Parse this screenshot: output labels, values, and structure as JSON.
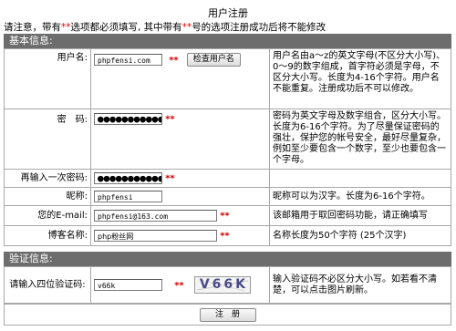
{
  "page": {
    "title": "用户注册",
    "notice_prefix": "请注意，带有",
    "notice_star1": "**",
    "notice_middle": "选项都必须填写, 其中带有",
    "notice_star2": "**",
    "notice_suffix": "号的选项注册成功后将不能修改"
  },
  "sections": {
    "basic": "基本信息:",
    "verify": "验证信息:"
  },
  "fields": {
    "username": {
      "label": "用户名:",
      "value": "phpfensi.com",
      "required": "**",
      "check_button": "检查用户名",
      "hint": "用户名由a～z的英文字母(不区分大小写)、0～9的数字组成，首字符必须是字母，不区分大小写。长度为4-16个字符。用户名不能重复。注册成功后不可以修改。"
    },
    "password": {
      "label": "密　码:",
      "value": "●●●●●●●●●●●",
      "required": "**",
      "hint": "密码为英文字母及数字组合，区分大小写。长度为6-16个字符。为了尽量保证密码的强壮，保护您的帐号安全，最好尽量复杂，例如至少要包含一个数字，至少也要包含一个字母。"
    },
    "password_confirm": {
      "label": "再输入一次密码:",
      "value": "●●●●●●●●●●●",
      "required": "**",
      "hint": ""
    },
    "nickname": {
      "label": "昵称:",
      "value": "phpfensi",
      "hint": "昵称可以为汉字。长度为6-16个字符。"
    },
    "email": {
      "label": "您的E-mail:",
      "value": "phpfensi@163.com",
      "required": "**",
      "hint": "该邮箱用于取回密码功能，请正确填写"
    },
    "blog": {
      "label": "博客名称:",
      "value": "php粉丝网",
      "required": "**",
      "hint": "名称长度为50个字符 (25个汉字)"
    },
    "captcha": {
      "label": "请输入四位验证码:",
      "value": "v66k",
      "required": "**",
      "image_text": "V66K",
      "hint": "输入验证码不必区分大小写。如若看不清楚，可以点击图片刷新。"
    }
  },
  "submit_label": "注　册",
  "colors": {
    "required": "#d40000",
    "section_bg": "#6d6d6d",
    "border": "#a8a8a8"
  }
}
